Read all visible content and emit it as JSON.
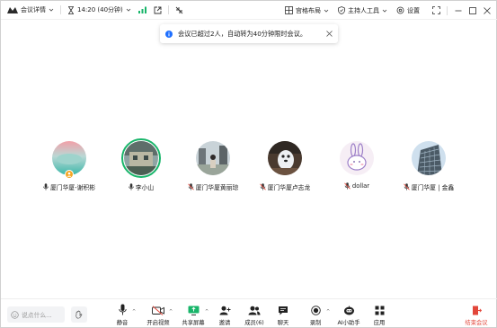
{
  "titlebar": {
    "meeting_details": "会议详情",
    "time": "14:20 (40分钟)",
    "layout": "宫格布局",
    "host_tools": "主持人工具",
    "settings": "设置"
  },
  "notice": {
    "text": "会议已超过2人，自动转为40分钟限时会议。"
  },
  "participants": [
    {
      "name": "厦门华厦-谢积彬",
      "mic": "on",
      "host": true,
      "active": false
    },
    {
      "name": "李小山",
      "mic": "on",
      "host": false,
      "active": true
    },
    {
      "name": "厦门华厦黄丽琼",
      "mic": "muted",
      "host": false,
      "active": false
    },
    {
      "name": "厦门华厦卢志龙",
      "mic": "muted",
      "host": false,
      "active": false
    },
    {
      "name": "dollar",
      "mic": "muted",
      "host": false,
      "active": false
    },
    {
      "name": "厦门华厦 | 金鑫",
      "mic": "muted",
      "host": false,
      "active": false
    }
  ],
  "bottombar": {
    "chat_placeholder": "说点什么...",
    "tools": {
      "mute": "静音",
      "video": "开启视频",
      "share": "共享屏幕",
      "invite": "邀请",
      "members": "成员(6)",
      "chat": "聊天",
      "record": "录制",
      "ai": "AI小助手",
      "apps": "应用",
      "end": "结束会议"
    }
  },
  "colors": {
    "accent_green": "#18b56a",
    "end_red": "#e2463a",
    "info_blue": "#1e6fff",
    "host_badge": "#f5a623"
  }
}
